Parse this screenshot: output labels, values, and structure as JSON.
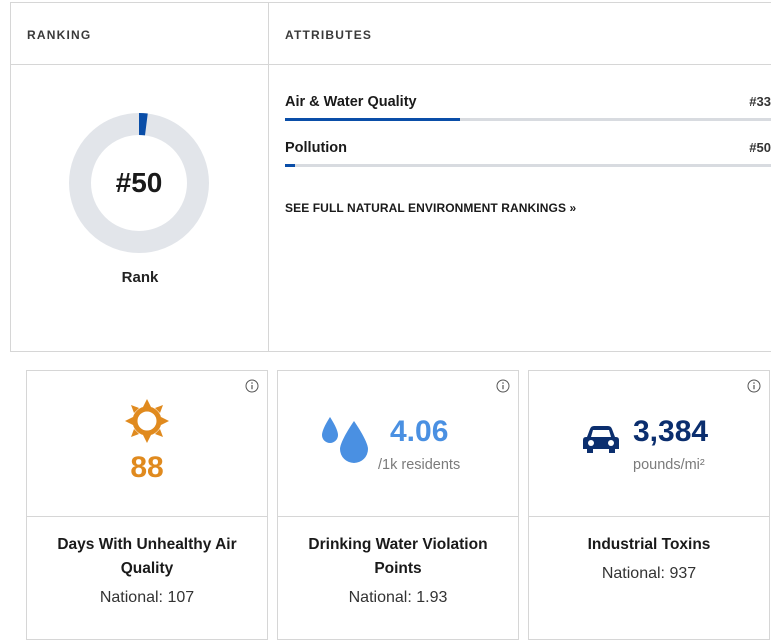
{
  "ranking": {
    "header": "RANKING",
    "rank_text": "#50",
    "rank_label": "Rank",
    "rank_fraction": 0.02
  },
  "attributes": {
    "header": "ATTRIBUTES",
    "items": [
      {
        "name": "Air & Water Quality",
        "rank": "#33",
        "fraction": 0.36
      },
      {
        "name": "Pollution",
        "rank": "#50",
        "fraction": 0.02
      }
    ],
    "see_full": "SEE FULL NATURAL ENVIRONMENT RANKINGS »"
  },
  "cards": [
    {
      "icon": "sun-icon",
      "value": "88",
      "unit": "",
      "title": "Days With Unhealthy Air Quality",
      "national": "National: 107",
      "color": "#e08a1e"
    },
    {
      "icon": "water-drops-icon",
      "value": "4.06",
      "unit": "/1k residents",
      "title": "Drinking Water Violation Points",
      "national": "National: 1.93",
      "color": "#4a90e2"
    },
    {
      "icon": "car-icon",
      "value": "3,384",
      "unit": "pounds/mi²",
      "title": "Industrial Toxins",
      "national": "National: 937",
      "color": "#0b2e6e"
    }
  ],
  "colors": {
    "accent": "#0a4ea8",
    "donut_track": "#e2e5ea",
    "border": "#d6d6d6"
  }
}
